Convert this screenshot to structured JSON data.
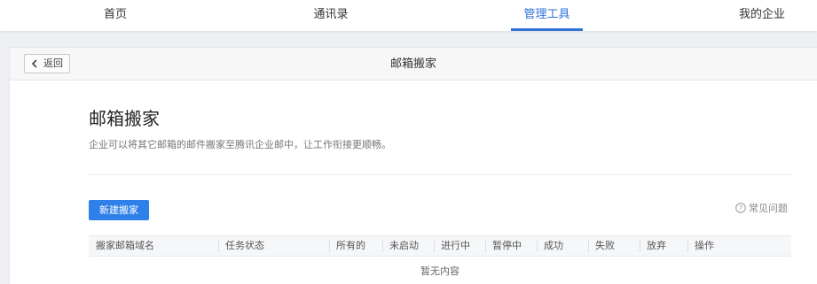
{
  "nav": {
    "tabs": [
      {
        "label": "首页"
      },
      {
        "label": "通讯录"
      },
      {
        "label": "管理工具",
        "active": true
      },
      {
        "label": "我的企业"
      }
    ]
  },
  "header": {
    "back_label": "返回",
    "title": "邮箱搬家"
  },
  "main": {
    "heading": "邮箱搬家",
    "description": "企业可以将其它邮箱的邮件搬家至腾讯企业邮中，让工作衔接更顺畅。",
    "new_button": "新建搬家",
    "faq_label": "常见问题",
    "accent_color": "#2f80e8"
  },
  "table": {
    "columns": [
      "搬家邮箱域名",
      "任务状态",
      "所有的",
      "未启动",
      "进行中",
      "暂停中",
      "成功",
      "失败",
      "放弃",
      "操作"
    ],
    "empty_text": "暂无内容"
  }
}
